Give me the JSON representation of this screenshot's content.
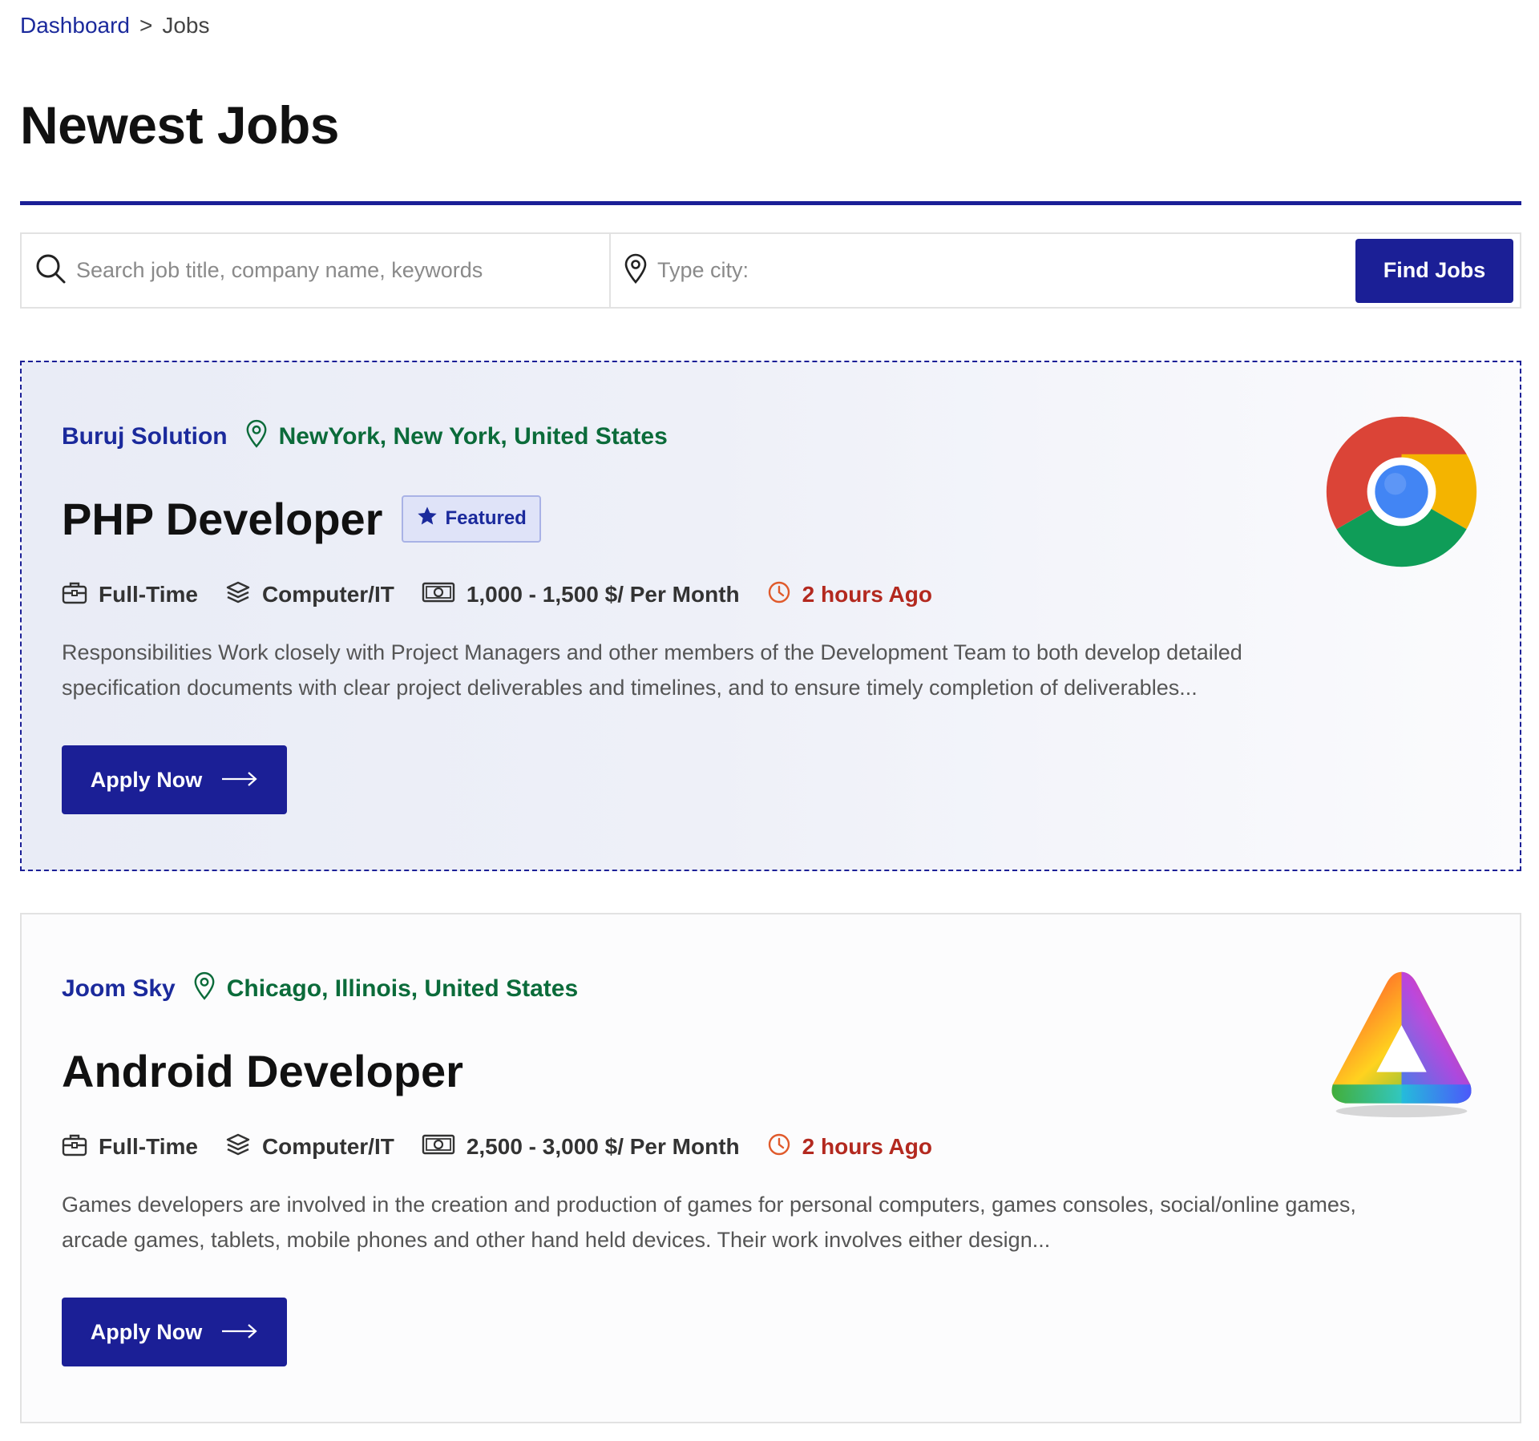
{
  "breadcrumb": {
    "home": "Dashboard",
    "separator": ">",
    "current": "Jobs"
  },
  "page_title": "Newest Jobs",
  "search": {
    "keyword_placeholder": "Search job title, company name, keywords",
    "city_placeholder": "Type city:",
    "button_label": "Find Jobs"
  },
  "colors": {
    "primary": "#1b1f96",
    "link": "#1b2a9c",
    "location": "#0b6b3a",
    "time": "#b3291f"
  },
  "jobs": [
    {
      "company": "Buruj Solution",
      "location": "NewYork, New York, United States",
      "title": "PHP Developer",
      "badge": "Featured",
      "type": "Full-Time",
      "category": "Computer/IT",
      "salary": "1,000 - 1,500 $/ Per Month",
      "posted": "2 hours Ago",
      "description": "Responsibilities Work closely with Project Managers and other members of the Development Team to both develop detailed specification documents with clear project deliverables and timelines, and to ensure timely completion of deliverables...",
      "apply_label": "Apply Now",
      "logo_icon": "chrome-logo"
    },
    {
      "company": "Joom Sky",
      "location": "Chicago, Illinois, United States",
      "title": "Android Developer",
      "type": "Full-Time",
      "category": "Computer/IT",
      "salary": "2,500 - 3,000 $/ Per Month",
      "posted": "2 hours Ago",
      "description": "Games developers are involved in the creation and production of games for personal computers, games consoles, social/online games, arcade games, tablets, mobile phones and other hand held devices. Their work involves either design...",
      "apply_label": "Apply Now",
      "logo_icon": "rainbow-triangle-logo"
    }
  ]
}
